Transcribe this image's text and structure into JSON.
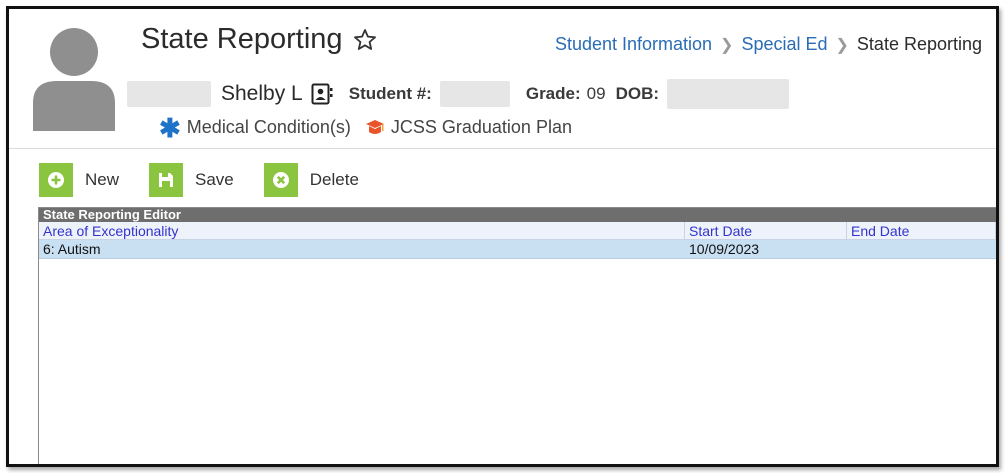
{
  "header": {
    "title": "State Reporting",
    "breadcrumb": [
      "Student Information",
      "Special Ed",
      "State Reporting"
    ],
    "student": {
      "name": "Shelby L",
      "student_number_label": "Student #:",
      "grade_label": "Grade:",
      "grade_value": "09",
      "dob_label": "DOB:"
    },
    "flags": {
      "medical": "Medical Condition(s)",
      "graduation_plan": "JCSS Graduation Plan"
    }
  },
  "toolbar": {
    "new_label": "New",
    "save_label": "Save",
    "delete_label": "Delete"
  },
  "editor": {
    "title": "State Reporting Editor",
    "columns": [
      "Area of Exceptionality",
      "Start Date",
      "End Date"
    ],
    "rows": [
      {
        "area": "6: Autism",
        "start": "10/09/2023",
        "end": ""
      }
    ]
  },
  "colors": {
    "accent_green": "#8bc53f",
    "link_blue": "#2a6db5",
    "selected_row": "#c9dff2",
    "header_bar": "#6e6e6e"
  }
}
